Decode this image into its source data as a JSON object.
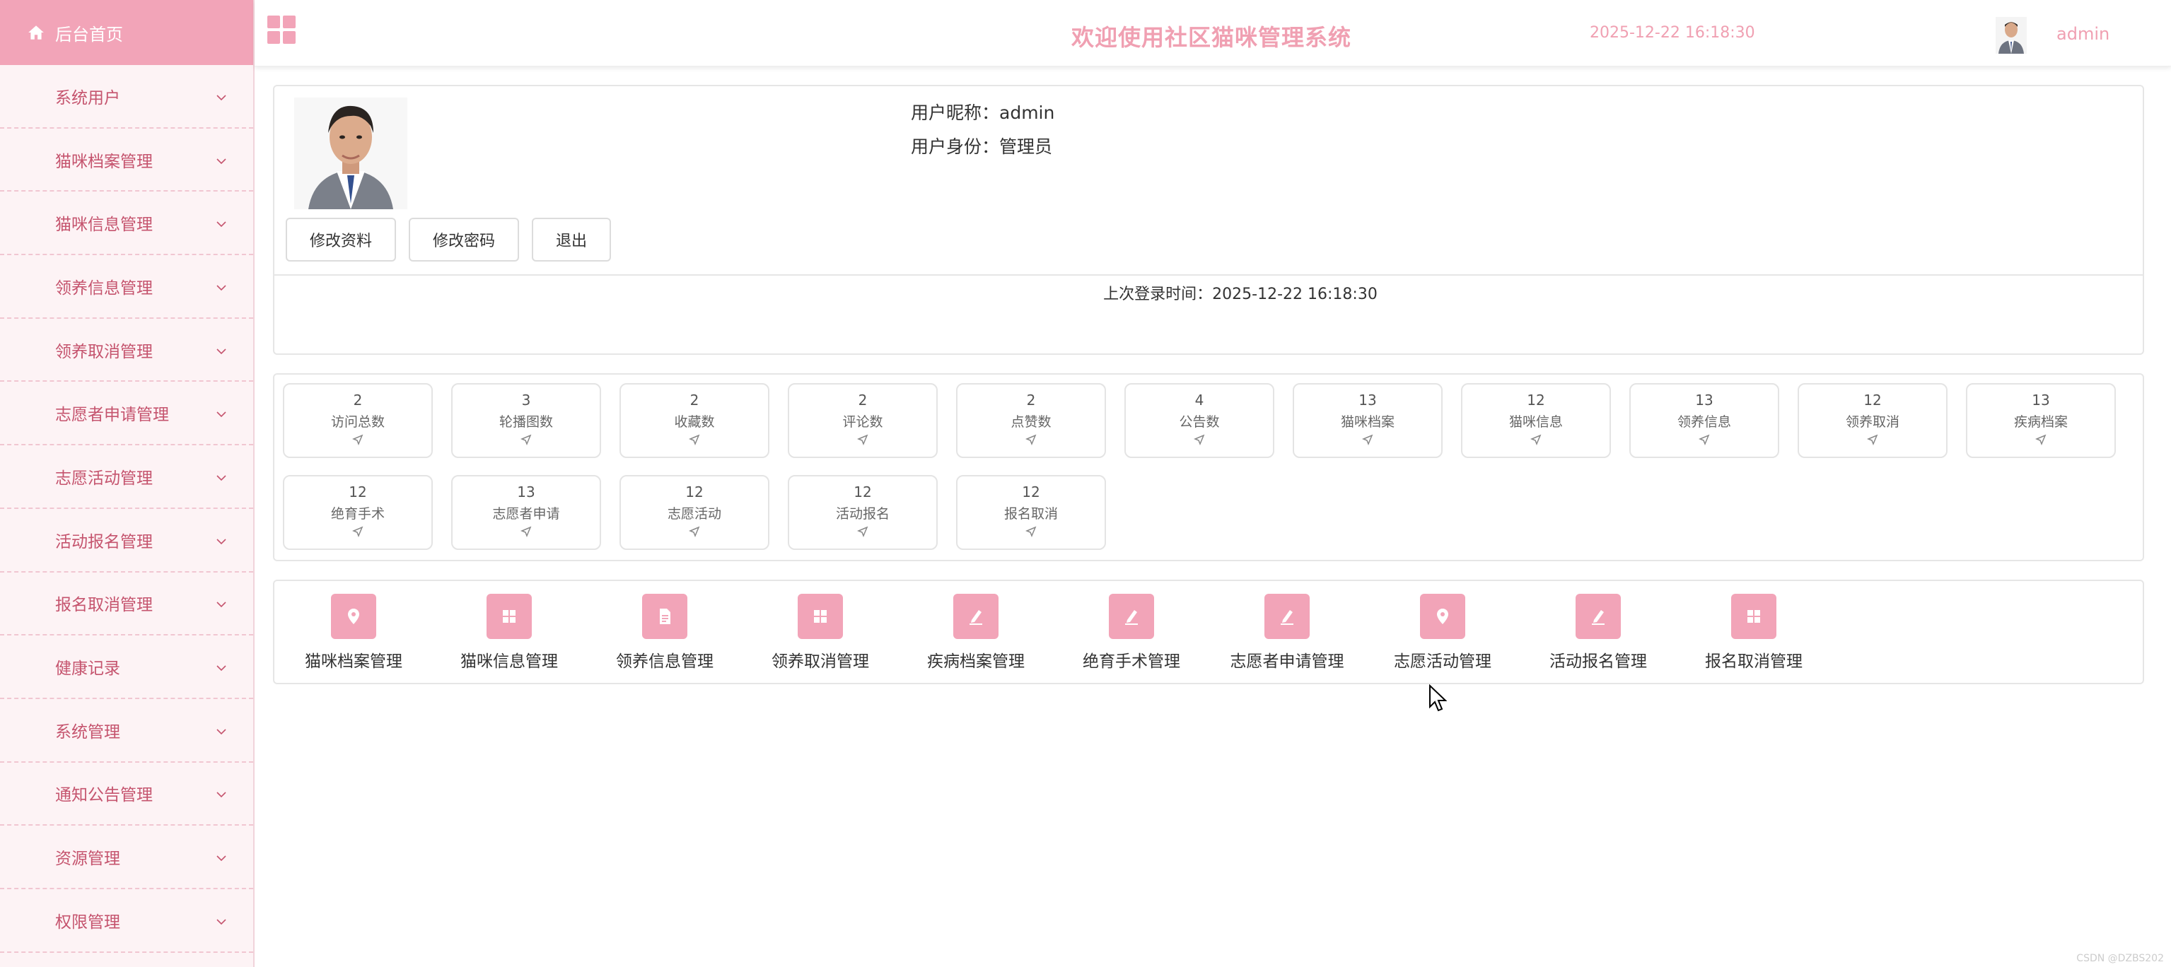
{
  "sidebar": {
    "home_label": "后台首页",
    "items": [
      {
        "label": "系统用户"
      },
      {
        "label": "猫咪档案管理"
      },
      {
        "label": "猫咪信息管理"
      },
      {
        "label": "领养信息管理"
      },
      {
        "label": "领养取消管理"
      },
      {
        "label": "志愿者申请管理"
      },
      {
        "label": "志愿活动管理"
      },
      {
        "label": "活动报名管理"
      },
      {
        "label": "报名取消管理"
      },
      {
        "label": "健康记录"
      },
      {
        "label": "系统管理"
      },
      {
        "label": "通知公告管理"
      },
      {
        "label": "资源管理"
      },
      {
        "label": "权限管理"
      }
    ]
  },
  "header": {
    "title": "欢迎使用社区猫咪管理系统",
    "datetime": "2025-12-22 16:18:30",
    "username": "admin"
  },
  "profile": {
    "nickname_label": "用户昵称：",
    "nickname": "admin",
    "role_label": "用户身份：",
    "role": "管理员",
    "buttons": {
      "edit_profile": "修改资料",
      "change_password": "修改密码",
      "logout": "退出"
    },
    "last_login_label": "上次登录时间：",
    "last_login": "2025-12-22 16:18:30"
  },
  "stats": [
    {
      "value": "2",
      "label": "访问总数"
    },
    {
      "value": "3",
      "label": "轮播图数"
    },
    {
      "value": "2",
      "label": "收藏数"
    },
    {
      "value": "2",
      "label": "评论数"
    },
    {
      "value": "2",
      "label": "点赞数"
    },
    {
      "value": "4",
      "label": "公告数"
    },
    {
      "value": "13",
      "label": "猫咪档案"
    },
    {
      "value": "12",
      "label": "猫咪信息"
    },
    {
      "value": "13",
      "label": "领养信息"
    },
    {
      "value": "12",
      "label": "领养取消"
    },
    {
      "value": "13",
      "label": "疾病档案"
    },
    {
      "value": "12",
      "label": "绝育手术"
    },
    {
      "value": "13",
      "label": "志愿者申请"
    },
    {
      "value": "12",
      "label": "志愿活动"
    },
    {
      "value": "12",
      "label": "活动报名"
    },
    {
      "value": "12",
      "label": "报名取消"
    }
  ],
  "modules": [
    {
      "label": "猫咪档案管理",
      "icon": "location-pin-icon"
    },
    {
      "label": "猫咪信息管理",
      "icon": "grid-icon"
    },
    {
      "label": "领养信息管理",
      "icon": "document-icon"
    },
    {
      "label": "领养取消管理",
      "icon": "grid-icon"
    },
    {
      "label": "疾病档案管理",
      "icon": "edit-icon"
    },
    {
      "label": "绝育手术管理",
      "icon": "edit-icon"
    },
    {
      "label": "志愿者申请管理",
      "icon": "edit-icon"
    },
    {
      "label": "志愿活动管理",
      "icon": "location-pin-icon"
    },
    {
      "label": "活动报名管理",
      "icon": "edit-icon"
    },
    {
      "label": "报名取消管理",
      "icon": "grid-icon"
    }
  ],
  "watermark": "CSDN @DZBS202",
  "colors": {
    "accent": "#f2a4b8",
    "sidebar_bg": "#fdf3f5",
    "menu_text": "#c5546e",
    "header_text": "#f0a0b2"
  }
}
